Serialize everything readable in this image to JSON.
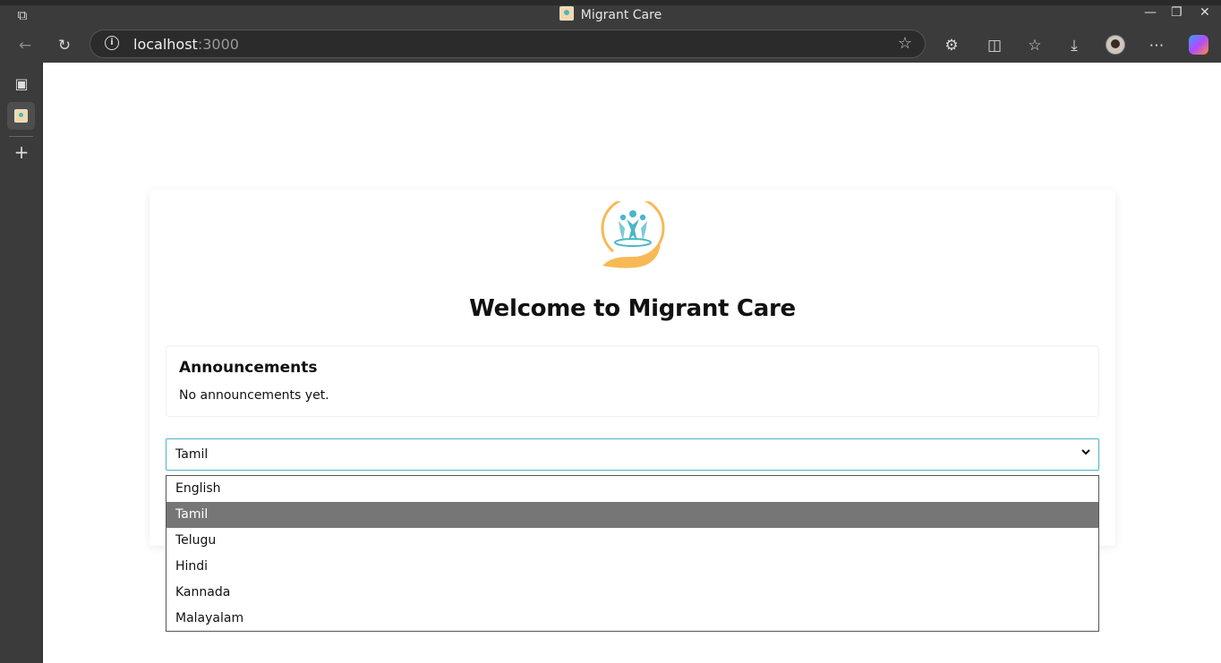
{
  "browser": {
    "window_title": "Migrant Care",
    "url_host": "localhost",
    "url_port": ":3000"
  },
  "page": {
    "welcome": "Welcome to Migrant Care",
    "announcements": {
      "heading": "Announcements",
      "empty_text": "No announcements yet."
    },
    "language_select": {
      "selected": "Tamil",
      "options": [
        "English",
        "Tamil",
        "Telugu",
        "Hindi",
        "Kannada",
        "Malayalam"
      ],
      "highlighted_index": 1
    }
  },
  "colors": {
    "accent_teal": "#48b6c4",
    "logo_orange": "#f7b955",
    "highlight": "#767676"
  }
}
